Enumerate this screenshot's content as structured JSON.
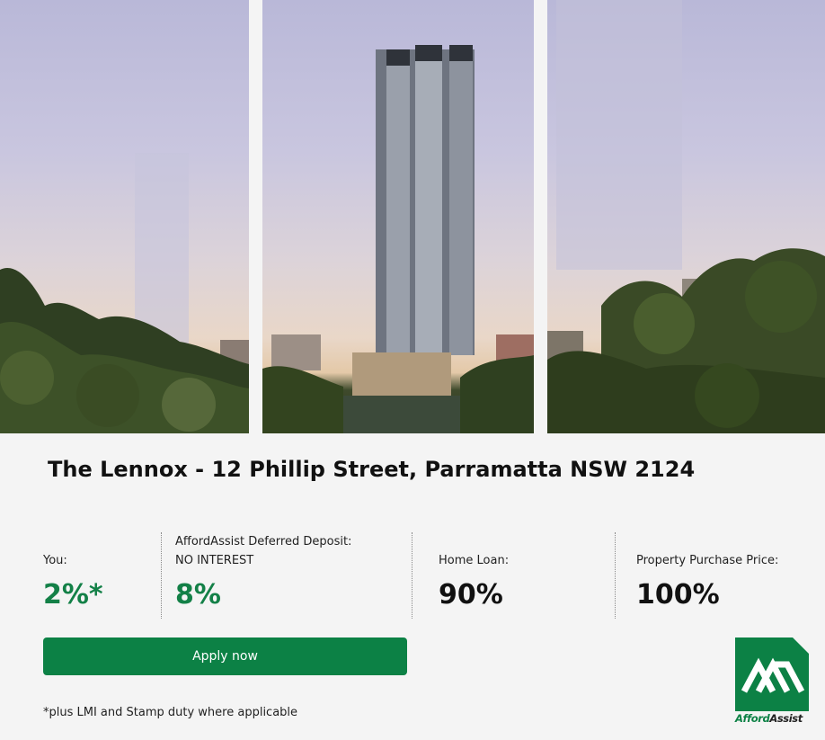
{
  "property": {
    "title": "The Lennox - 12 Phillip Street, Parramatta NSW 2124"
  },
  "stats": [
    {
      "label": "You:",
      "label2": "",
      "value": "2%*"
    },
    {
      "label": "AffordAssist Deferred Deposit:",
      "label2": "NO INTEREST",
      "value": "8%"
    },
    {
      "label": "Home Loan:",
      "label2": "",
      "value": "90%"
    },
    {
      "label": "Property Purchase Price:",
      "label2": "",
      "value": "100%"
    }
  ],
  "cta": {
    "label": "Apply now"
  },
  "footnote": "*plus LMI and Stamp duty where applicable",
  "logo": {
    "brand_part1": "Afford",
    "brand_part2": "Assist"
  },
  "colors": {
    "accent": "#0c8145",
    "value_green": "#138047",
    "background": "#f4f4f4"
  }
}
